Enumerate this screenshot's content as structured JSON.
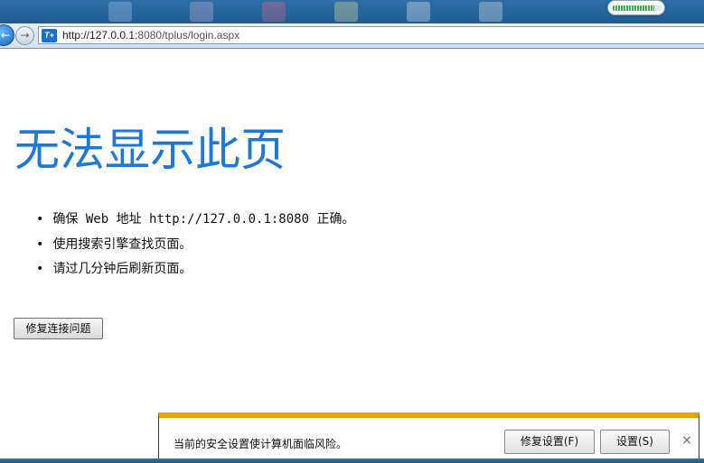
{
  "browser": {
    "url_host": "http://127.0.0.1:",
    "url_rest": "8080/tplus/login.aspx",
    "site_icon_text": "T+",
    "back_icon": "arrow-left-icon",
    "forward_icon": "arrow-right-icon",
    "load_progress": 0.85
  },
  "page": {
    "title": "无法显示此页",
    "suggestions": [
      "确保 Web 地址 http://127.0.0.1:8080 正确。",
      "使用搜索引擎查找页面。",
      "请过几分钟后刷新页面。"
    ],
    "bullet": "•",
    "fix_button": "修复连接问题"
  },
  "notification": {
    "message": "当前的安全设置使计算机面临风险。",
    "fix_settings_button": "修复设置(F)",
    "settings_button": "设置(S)",
    "close_glyph": "×"
  },
  "colors": {
    "title": "#1d79d8",
    "notify_accent": "#e8a300"
  }
}
